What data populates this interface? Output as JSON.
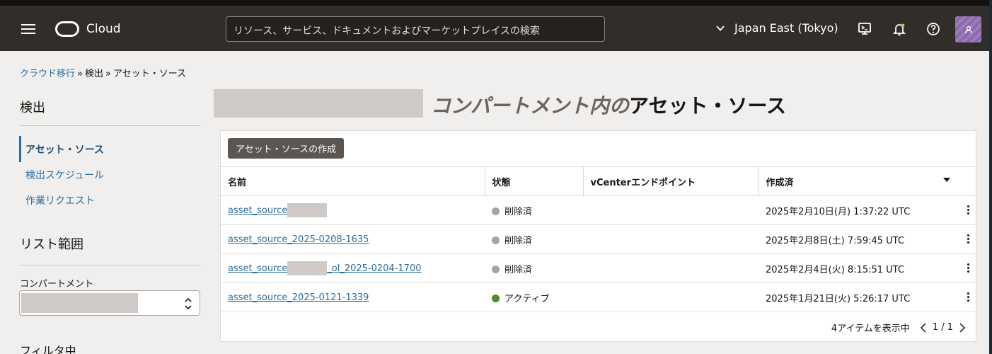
{
  "topbar": {
    "brand": "Cloud",
    "search_placeholder": "リソース、サービス、ドキュメントおよびマーケットプレイスの検索",
    "region": "Japan East (Tokyo)"
  },
  "breadcrumb": {
    "item1": "クラウド移行",
    "sep": "»",
    "item2": "検出",
    "item3": "アセット・ソース"
  },
  "sidebar": {
    "heading": "検出",
    "items": [
      {
        "label": "アセット・ソース"
      },
      {
        "label": "検出スケジュール"
      },
      {
        "label": "作業リクエスト"
      }
    ],
    "scope_heading": "リスト範囲",
    "compartment_label": "コンパートメント",
    "filter_heading": "フィルタ中"
  },
  "main": {
    "title_italic": "コンパートメント内の",
    "title_rest": "アセット・ソース",
    "create_button": "アセット・ソースの作成",
    "columns": [
      "名前",
      "状態",
      "vCenterエンドポイント",
      "作成済"
    ],
    "rows": [
      {
        "name_a": "asset_source",
        "name_b": "",
        "state": "削除済",
        "state_color": "#a9a39d",
        "endpoint": "",
        "created": "2025年2月10日(月) 1:37:22 UTC"
      },
      {
        "name_a": "asset_source_2025-0208-1635",
        "name_b": "",
        "state": "削除済",
        "state_color": "#a9a39d",
        "endpoint": "",
        "created": "2025年2月8日(土) 7:59:45 UTC"
      },
      {
        "name_a": "asset_source",
        "name_b": "_ol_2025-0204-1700",
        "state": "削除済",
        "state_color": "#a9a39d",
        "endpoint": "",
        "created": "2025年2月4日(火) 8:15:51 UTC"
      },
      {
        "name_a": "asset_source_2025-0121-1339",
        "name_b": "",
        "state": "アクティブ",
        "state_color": "#4f8a2b",
        "endpoint": "",
        "created": "2025年1月21日(火) 5:26:17 UTC"
      }
    ],
    "footer": {
      "count": "4アイテムを表示中",
      "page": "1 / 1"
    }
  },
  "icons": [
    "menu-icon",
    "oracle-logo-icon",
    "chevron-down-icon",
    "cloud-shell-icon",
    "bell-icon",
    "help-icon",
    "avatar-icon",
    "kebab-icon",
    "sort-caret-icon",
    "select-updown-icon",
    "prev-page-icon",
    "next-page-icon"
  ]
}
